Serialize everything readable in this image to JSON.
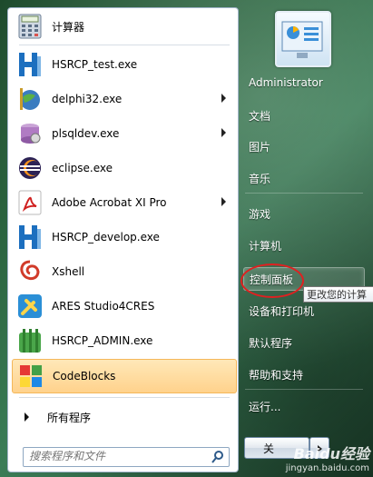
{
  "start_menu": {
    "programs": [
      {
        "label": "计算器",
        "icon": "calculator-icon",
        "has_submenu": false
      },
      {
        "label": "HSRCP_test.exe",
        "icon": "hsrcp-icon",
        "has_submenu": false
      },
      {
        "label": "delphi32.exe",
        "icon": "delphi-icon",
        "has_submenu": true
      },
      {
        "label": "plsqldev.exe",
        "icon": "plsql-developer-icon",
        "has_submenu": true
      },
      {
        "label": "eclipse.exe",
        "icon": "eclipse-icon",
        "has_submenu": false
      },
      {
        "label": "Adobe Acrobat XI Pro",
        "icon": "adobe-acrobat-icon",
        "has_submenu": true
      },
      {
        "label": "HSRCP_develop.exe",
        "icon": "hsrcp-icon",
        "has_submenu": false
      },
      {
        "label": "Xshell",
        "icon": "xshell-icon",
        "has_submenu": false
      },
      {
        "label": "ARES Studio4CRES",
        "icon": "ares-studio-icon",
        "has_submenu": false
      },
      {
        "label": "HSRCP_ADMIN.exe",
        "icon": "hsrcp-admin-icon",
        "has_submenu": false
      },
      {
        "label": "CodeBlocks",
        "icon": "codeblocks-icon",
        "has_submenu": false,
        "highlighted": true
      }
    ],
    "all_programs": "所有程序",
    "search": {
      "placeholder": "搜索程序和文件"
    },
    "right": {
      "user": "Administrator",
      "items": [
        "文档",
        "图片",
        "音乐",
        "游戏",
        "计算机",
        "控制面板",
        "设备和打印机",
        "默认程序",
        "帮助和支持",
        "运行..."
      ],
      "active": "控制面板"
    },
    "tooltip": "更改您的计算",
    "shutdown_label": "关",
    "colors": {
      "highlight": "#ffd28c",
      "annotation": "#e02020"
    }
  },
  "watermark": {
    "brand": "Baidu经验",
    "url": "jingyan.baidu.com"
  }
}
